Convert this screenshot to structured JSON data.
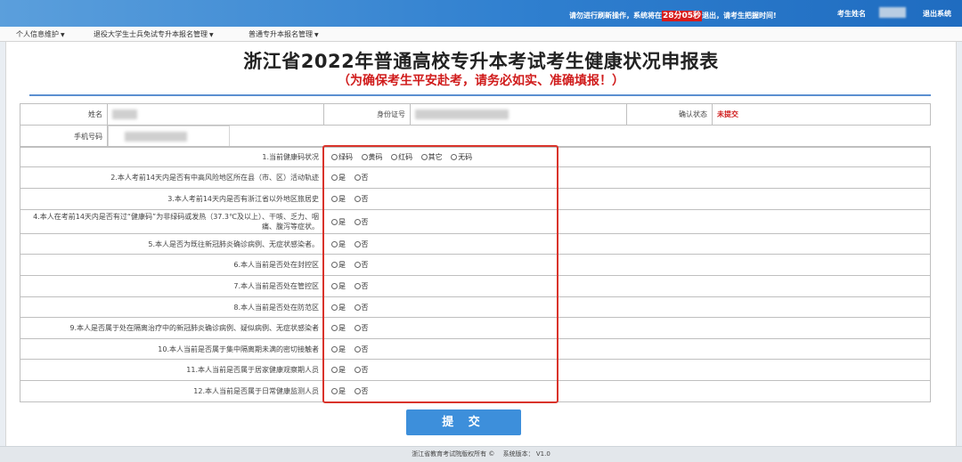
{
  "topbar": {
    "notice_prefix": "请勿进行刷新操作，系统将在",
    "timer": "28分05秒",
    "notice_suffix": "退出，请考生把握时间!",
    "candidate_label": "考生姓名",
    "logout": "退出系统",
    "accent_color": "#2f7fcf"
  },
  "menu": [
    {
      "label": "个人信息维护"
    },
    {
      "label": "退役大学生士兵免试专升本报名管理"
    },
    {
      "label": "普通专升本报名管理"
    }
  ],
  "form": {
    "title": "浙江省2022年普通高校专升本考试考生健康状况申报表",
    "subtitle": "（为确保考生平安赴考，请务必如实、准确填报！）",
    "name_label": "姓名",
    "id_label": "身份证号",
    "confirm_label": "确认状态",
    "confirm_status": "未提交",
    "phone_label": "手机号码"
  },
  "questions": [
    {
      "text": "1.当前健康码状况",
      "options": [
        "绿码",
        "黄码",
        "红码",
        "其它",
        "无码"
      ]
    },
    {
      "text": "2.本人考前14天内是否有中高风险地区所在县（市、区）活动轨迹",
      "options": [
        "是",
        "否"
      ]
    },
    {
      "text": "3.本人考前14天内是否有浙江省以外地区旅居史",
      "options": [
        "是",
        "否"
      ]
    },
    {
      "text": "4.本人在考前14天内是否有过“健康码”为非绿码或发热（37.3℃及以上）、干咳、乏力、咽痛、腹泻等症状。",
      "options": [
        "是",
        "否"
      ]
    },
    {
      "text": "5.本人是否为既往新冠肺炎确诊病例、无症状感染者。",
      "options": [
        "是",
        "否"
      ]
    },
    {
      "text": "6.本人当前是否处在封控区",
      "options": [
        "是",
        "否"
      ]
    },
    {
      "text": "7.本人当前是否处在管控区",
      "options": [
        "是",
        "否"
      ]
    },
    {
      "text": "8.本人当前是否处在防范区",
      "options": [
        "是",
        "否"
      ]
    },
    {
      "text": "9.本人是否属于处在隔离治疗中的新冠肺炎确诊病例、疑似病例、无症状感染者",
      "options": [
        "是",
        "否"
      ]
    },
    {
      "text": "10.本人当前是否属于集中隔离期未满的密切接触者",
      "options": [
        "是",
        "否"
      ]
    },
    {
      "text": "11.本人当前是否属于居家健康观察期人员",
      "options": [
        "是",
        "否"
      ]
    },
    {
      "text": "12.本人当前是否属于日常健康监测人员",
      "options": [
        "是",
        "否"
      ]
    }
  ],
  "submit_label": "提 交",
  "footer": "浙江省教育考试院版权所有 ©　 系统版本： V1.0",
  "colors": {
    "status_red": "#d01c1c",
    "highlight_border": "#d9332b",
    "submit_blue": "#3d8fdb"
  }
}
